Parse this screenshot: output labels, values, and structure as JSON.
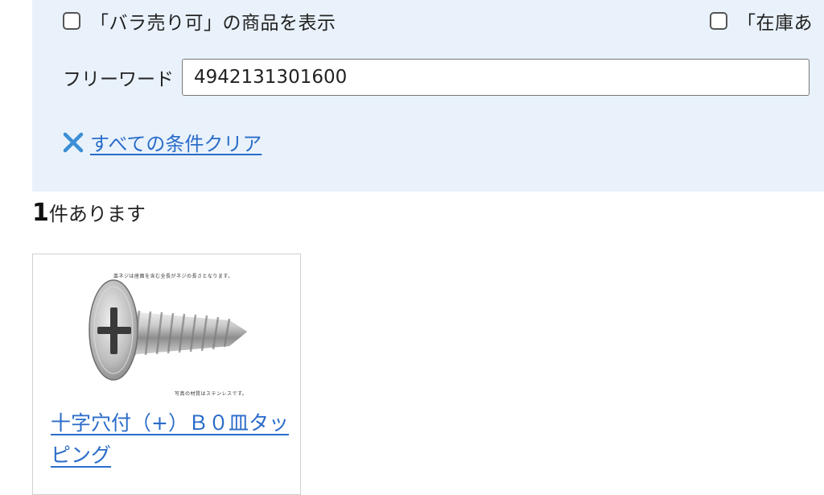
{
  "filters": {
    "checkbox_bara": {
      "label": "「バラ売り可」の商品を表示",
      "checked": false
    },
    "checkbox_stock": {
      "label": "「在庫あ",
      "checked": false
    },
    "freeword": {
      "label": "フリーワード",
      "value": "4942131301600"
    },
    "clear_all": {
      "label": "すべての条件クリア"
    }
  },
  "results": {
    "count": "1",
    "count_suffix": "件あります"
  },
  "products": [
    {
      "name": "十字穴付（+）Ｂ０皿タッピング",
      "image_caption_top": "皿ネジは座面を含む全長がネジの長さとなります。",
      "image_caption_bottom": "写真の材質はステンレスです。"
    }
  ],
  "colors": {
    "panel_bg": "#e9f2fb",
    "link": "#2a6cc9",
    "clear_icon": "#3b8fd6"
  }
}
